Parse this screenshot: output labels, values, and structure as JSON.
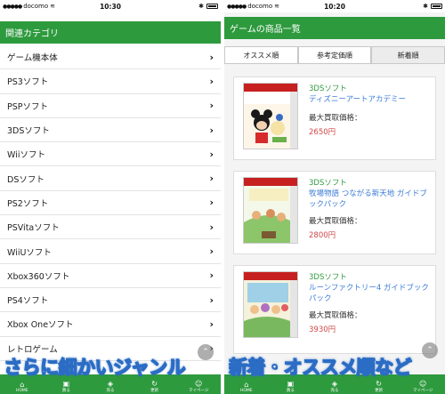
{
  "left_screen": {
    "status": {
      "carrier": "docomo",
      "time": "10:30"
    },
    "header": "関連カテゴリ",
    "categories": [
      "ゲーム機本体",
      "PS3ソフト",
      "PSPソフト",
      "3DSソフト",
      "Wiiソフト",
      "DSソフト",
      "PS2ソフト",
      "PSVitaソフト",
      "WiiUソフト",
      "Xbox360ソフト",
      "PS4ソフト",
      "Xbox Oneソフト",
      "レトロゲーム"
    ],
    "chevron": "›"
  },
  "right_screen": {
    "status": {
      "carrier": "docomo",
      "time": "10:20"
    },
    "header": "ゲームの商品一覧",
    "sort_tabs": [
      "オススメ順",
      "参考定価順",
      "新着順"
    ],
    "active_sort": "新着順",
    "products": [
      {
        "platform": "3DSソフト",
        "title": "ディズニーアートアカデミー",
        "price_label": "最大買取価格：",
        "price": "2650円"
      },
      {
        "platform": "3DSソフト",
        "title": "牧場物語 つながる新天地 ガイドブックパック",
        "price_label": "最大買取価格：",
        "price": "2800円"
      },
      {
        "platform": "3DSソフト",
        "title": "ルーンファクトリー4 ガイドブックパック",
        "price_label": "最大買取価格：",
        "price": "3930円"
      }
    ]
  },
  "tabbar": [
    "HOME",
    "買る",
    "売る",
    "更新",
    "マイページ"
  ],
  "captions": {
    "left": "さらに細かいジャンル",
    "right": "新着・オススメ順など"
  },
  "colors": {
    "brand_green": "#2e9a3e",
    "link_blue": "#3a7bd5",
    "price_red": "#d04848",
    "caption_outline": "#2b6cc4"
  }
}
